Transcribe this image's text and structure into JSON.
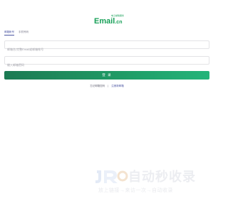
{
  "brand": {
    "name_main": "Email",
    "name_suffix": ".cn",
    "tagline": "电子邮箱服务",
    "color": "#18a058"
  },
  "tabs": [
    {
      "label": "邮箱帐号",
      "active": true
    },
    {
      "label": "手机号码",
      "active": false
    }
  ],
  "form": {
    "email_placeholder": "邮箱名/完整Email或邮箱帐号",
    "password_placeholder": "输入邮箱密码",
    "email_value": "",
    "password_value": ""
  },
  "login_button": {
    "label": "登 录",
    "color_start": "#1c7a53",
    "color_end": "#23b47a"
  },
  "links": {
    "forgot": "忘记邮箱密码",
    "separator": "|",
    "register": "注册新邮箱"
  },
  "watermark": {
    "title": "自动秒收录",
    "subtitle": "放上链接→来访一次→自动收录",
    "icon": "jr-logo-icon"
  },
  "accent_colors": {
    "tab_active": "#4a55a2",
    "watermark": "#e9ebef"
  }
}
